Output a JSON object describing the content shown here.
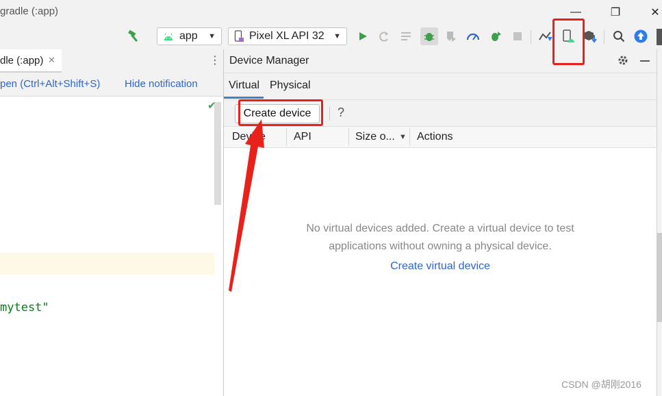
{
  "window": {
    "title": "gradle (:app)",
    "minimize_glyph": "—",
    "restore_glyph": "❐",
    "close_glyph": "✕"
  },
  "toolbar": {
    "module_combo": "app",
    "device_combo": "Pixel XL API 32",
    "icons": [
      "build-hammer-icon",
      "android-icon",
      "device-icon",
      "run-icon",
      "apply-changes-icon",
      "apply-code-icon",
      "debug-icon",
      "coverage-icon",
      "profiler-icon",
      "attach-debugger-icon",
      "stop-icon",
      "sync-icon",
      "device-manager-icon",
      "sdk-manager-icon",
      "search-icon",
      "update-icon"
    ],
    "colors": {
      "run": "#3aa14a",
      "android": "#3ddc84",
      "update": "#2b7de9"
    }
  },
  "left_pane": {
    "tab_label": "dle (:app)",
    "tab_close": "✕",
    "notification_text": "pen (Ctrl+Alt+Shift+S)",
    "notification_action": "Hide notification",
    "code_line": "mytest\""
  },
  "device_manager": {
    "title": "Device Manager",
    "tabs": [
      {
        "label": "Virtual",
        "active": true
      },
      {
        "label": "Physical",
        "active": false
      }
    ],
    "create_button": "Create device",
    "help": "?",
    "columns": [
      "Device",
      "API",
      "Size o...",
      "Actions"
    ],
    "empty_line1": "No virtual devices added. Create a virtual device to test",
    "empty_line2": "applications without owning a physical device.",
    "empty_link": "Create virtual device"
  },
  "annotation": {
    "color": "#e8221a"
  },
  "watermark": "CSDN @胡刚2016"
}
